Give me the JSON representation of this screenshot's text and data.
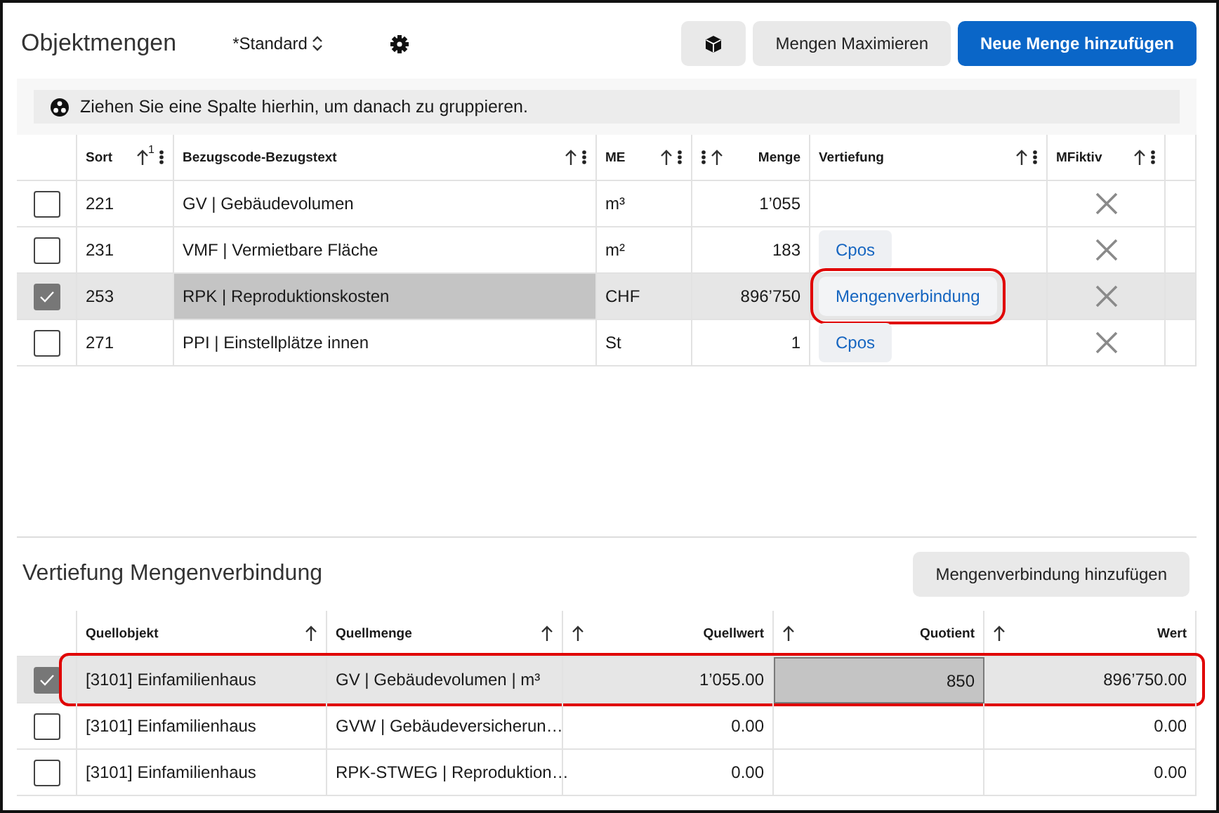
{
  "header": {
    "title": "Objektmengen",
    "view_selector": "*Standard",
    "buttons": [
      {
        "kind": "icon"
      },
      {
        "kind": "secondary",
        "label": "Mengen Maximieren"
      },
      {
        "kind": "primary",
        "label": "Neue Menge hinzufügen"
      }
    ]
  },
  "group_panel": {
    "text": "Ziehen Sie eine Spalte hierhin, um danach zu gruppieren."
  },
  "quantities_table": {
    "columns": [
      {
        "label": "Sort",
        "numeric": false,
        "sort_order": "1",
        "menu": true
      },
      {
        "label": "Bezugscode-Bezugstext",
        "numeric": false,
        "menu": true
      },
      {
        "label": "ME",
        "numeric": false,
        "menu": true
      },
      {
        "label": "Menge",
        "numeric": true,
        "menu": true
      },
      {
        "label": "Vertiefung",
        "numeric": false,
        "menu": true
      },
      {
        "label": "MFiktiv",
        "numeric": false,
        "menu": true
      }
    ],
    "rows": [
      {
        "selected": false,
        "cells": [
          {
            "text": "221",
            "focused": false
          },
          {
            "text": "GV | Gebäudevolumen",
            "focused": false
          },
          {
            "text": "m³",
            "focused": false
          },
          {
            "text": "1’055",
            "focused": false
          }
        ],
        "fictive": false
      },
      {
        "selected": false,
        "cells": [
          {
            "text": "231",
            "focused": false
          },
          {
            "text": "VMF | Vermietbare Fläche",
            "focused": false
          },
          {
            "text": "m²",
            "focused": false
          },
          {
            "text": "183",
            "focused": false
          }
        ],
        "detail": {
          "label": "Cpos",
          "highlighted": false
        },
        "fictive": false
      },
      {
        "selected": true,
        "cells": [
          {
            "text": "253",
            "focused": false
          },
          {
            "text": "RPK | Reproduktionskosten",
            "focused": true
          },
          {
            "text": "CHF",
            "focused": false
          },
          {
            "text": "896’750",
            "focused": false
          }
        ],
        "detail": {
          "label": "Mengenverbindung",
          "highlighted": true
        },
        "fictive": false
      },
      {
        "selected": false,
        "cells": [
          {
            "text": "271",
            "focused": false
          },
          {
            "text": "PPI | Einstellplätze innen",
            "focused": false
          },
          {
            "text": "St",
            "focused": false
          },
          {
            "text": "1",
            "focused": false
          }
        ],
        "detail": {
          "label": "Cpos",
          "highlighted": false
        },
        "fictive": false
      }
    ]
  },
  "detail_section": {
    "title": "Vertiefung Mengenverbindung",
    "add_button": "Mengenverbindung hinzufügen",
    "columns": [
      {
        "label": "Quellobjekt",
        "numeric": false,
        "menu": false
      },
      {
        "label": "Quellmenge",
        "numeric": false,
        "menu": false
      },
      {
        "label": "Quellwert",
        "numeric": true,
        "menu": false
      },
      {
        "label": "Quotient",
        "numeric": true,
        "menu": false
      },
      {
        "label": "Wert",
        "numeric": true,
        "menu": false
      }
    ],
    "rows": [
      {
        "selected": true,
        "highlighted": true,
        "cells": [
          {
            "text": "[3101] Einfamilienhaus",
            "focused": false
          },
          {
            "text": "GV | Gebäudevolumen | m³",
            "focused": false
          },
          {
            "text": "1’055.00",
            "focused": false
          },
          {
            "text": "850",
            "focused": true
          },
          {
            "text": "896’750.00",
            "focused": false
          }
        ]
      },
      {
        "selected": false,
        "highlighted": false,
        "cells": [
          {
            "text": "[3101] Einfamilienhaus",
            "focused": false
          },
          {
            "text": "GVW | Gebäudeversicherun…",
            "focused": false
          },
          {
            "text": "0.00",
            "focused": false
          },
          {
            "focused": false
          },
          {
            "text": "0.00",
            "focused": false
          }
        ]
      },
      {
        "selected": false,
        "highlighted": false,
        "cells": [
          {
            "text": "[3101] Einfamilienhaus",
            "focused": false
          },
          {
            "text": "RPK-STWEG | Reproduktion…",
            "focused": false
          },
          {
            "text": "0.00",
            "focused": false
          },
          {
            "focused": false
          },
          {
            "text": "0.00",
            "focused": false
          }
        ]
      }
    ]
  }
}
